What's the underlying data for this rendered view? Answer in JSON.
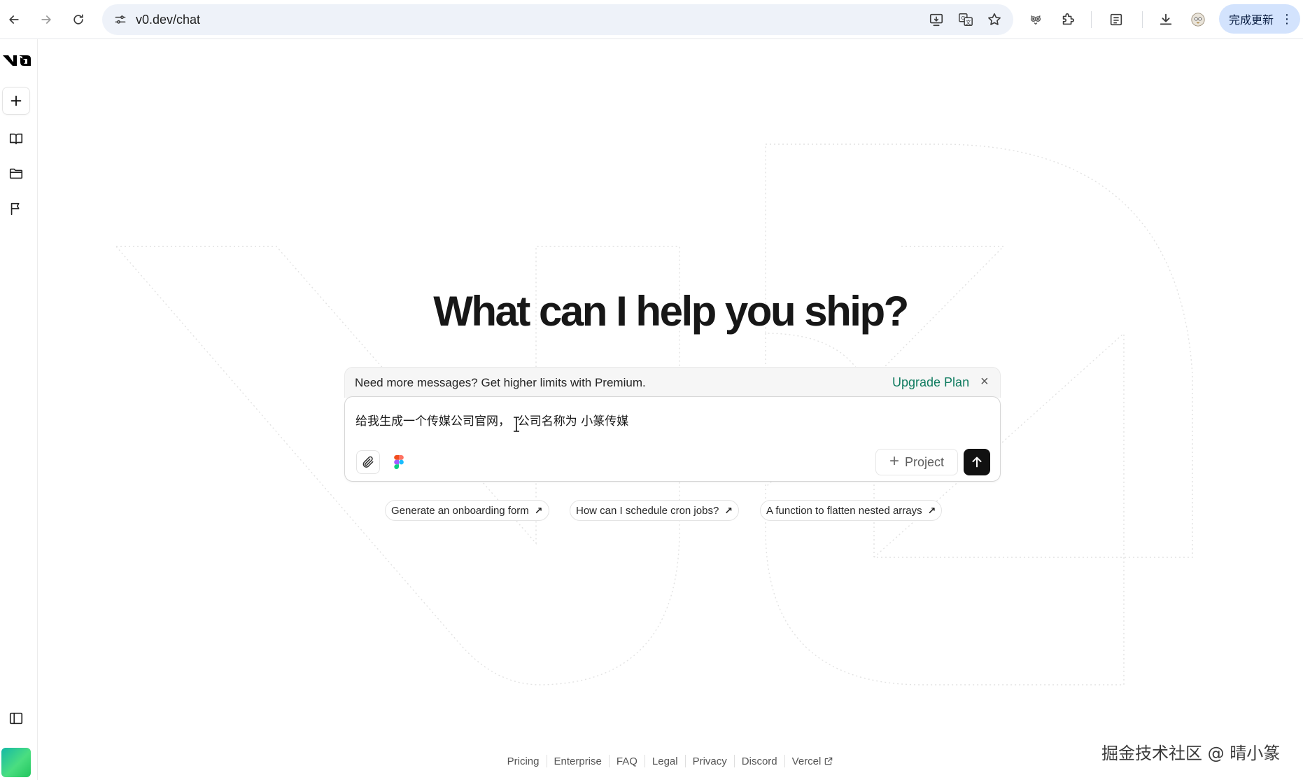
{
  "browser": {
    "url": "v0.dev/chat",
    "update_button_label": "完成更新",
    "icons": [
      "back-icon",
      "forward-icon",
      "reload-icon",
      "site-info-icon",
      "install-icon",
      "translate-icon",
      "bookmark-star-icon",
      "extension-owl-icon",
      "extensions-puzzle-icon",
      "reading-list-icon",
      "download-icon",
      "profile-avatar-icon",
      "more-vert-icon"
    ]
  },
  "sidebar": {
    "logo": "v0",
    "items": [
      {
        "name": "new-chat",
        "icon": "plus-icon"
      },
      {
        "name": "library",
        "icon": "book-icon"
      },
      {
        "name": "projects",
        "icon": "folder-icon"
      },
      {
        "name": "feedback",
        "icon": "flag-icon"
      }
    ],
    "toggle_icon": "sidebar-toggle-icon"
  },
  "main": {
    "title": "What can I help you ship?",
    "banner": {
      "text": "Need more messages? Get higher limits with Premium.",
      "link": "Upgrade Plan",
      "close": "×"
    },
    "prompt": {
      "value": "给我生成一个传媒公司官网，  公司名称为 小篆传媒"
    },
    "project_button": "Project",
    "accent_color": "#0f7b5f",
    "suggestions": [
      "Generate an onboarding form",
      "How can I schedule cron jobs?",
      "A function to flatten nested arrays"
    ]
  },
  "footer": {
    "links": [
      "Pricing",
      "Enterprise",
      "FAQ",
      "Legal",
      "Privacy",
      "Discord",
      "Vercel"
    ]
  },
  "watermark": "掘金技术社区 @ 晴小篆"
}
